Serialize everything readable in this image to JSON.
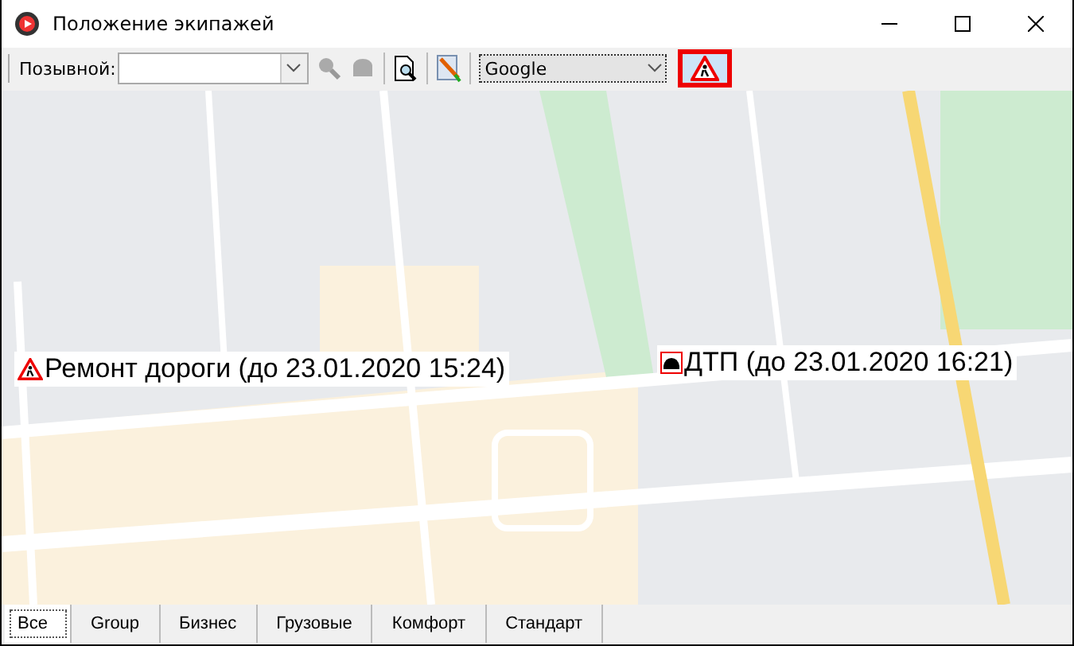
{
  "window": {
    "title": "Положение экипажей"
  },
  "toolbar": {
    "callsign_label": "Позывной:",
    "map_provider": "Google",
    "road_works_toggle": {
      "on": true
    }
  },
  "map": {
    "incidents": [
      {
        "kind": "road_works",
        "label": "Ремонт дороги (до 23.01.2020 15:24)"
      },
      {
        "kind": "accident",
        "label": "ДТП (до 23.01.2020 16:21)"
      }
    ]
  },
  "tabs": [
    {
      "label": "Все",
      "selected": true
    },
    {
      "label": "Group",
      "selected": false
    },
    {
      "label": "Бизнес",
      "selected": false
    },
    {
      "label": "Грузовые",
      "selected": false
    },
    {
      "label": "Комфорт",
      "selected": false
    },
    {
      "label": "Стандарт",
      "selected": false
    }
  ]
}
